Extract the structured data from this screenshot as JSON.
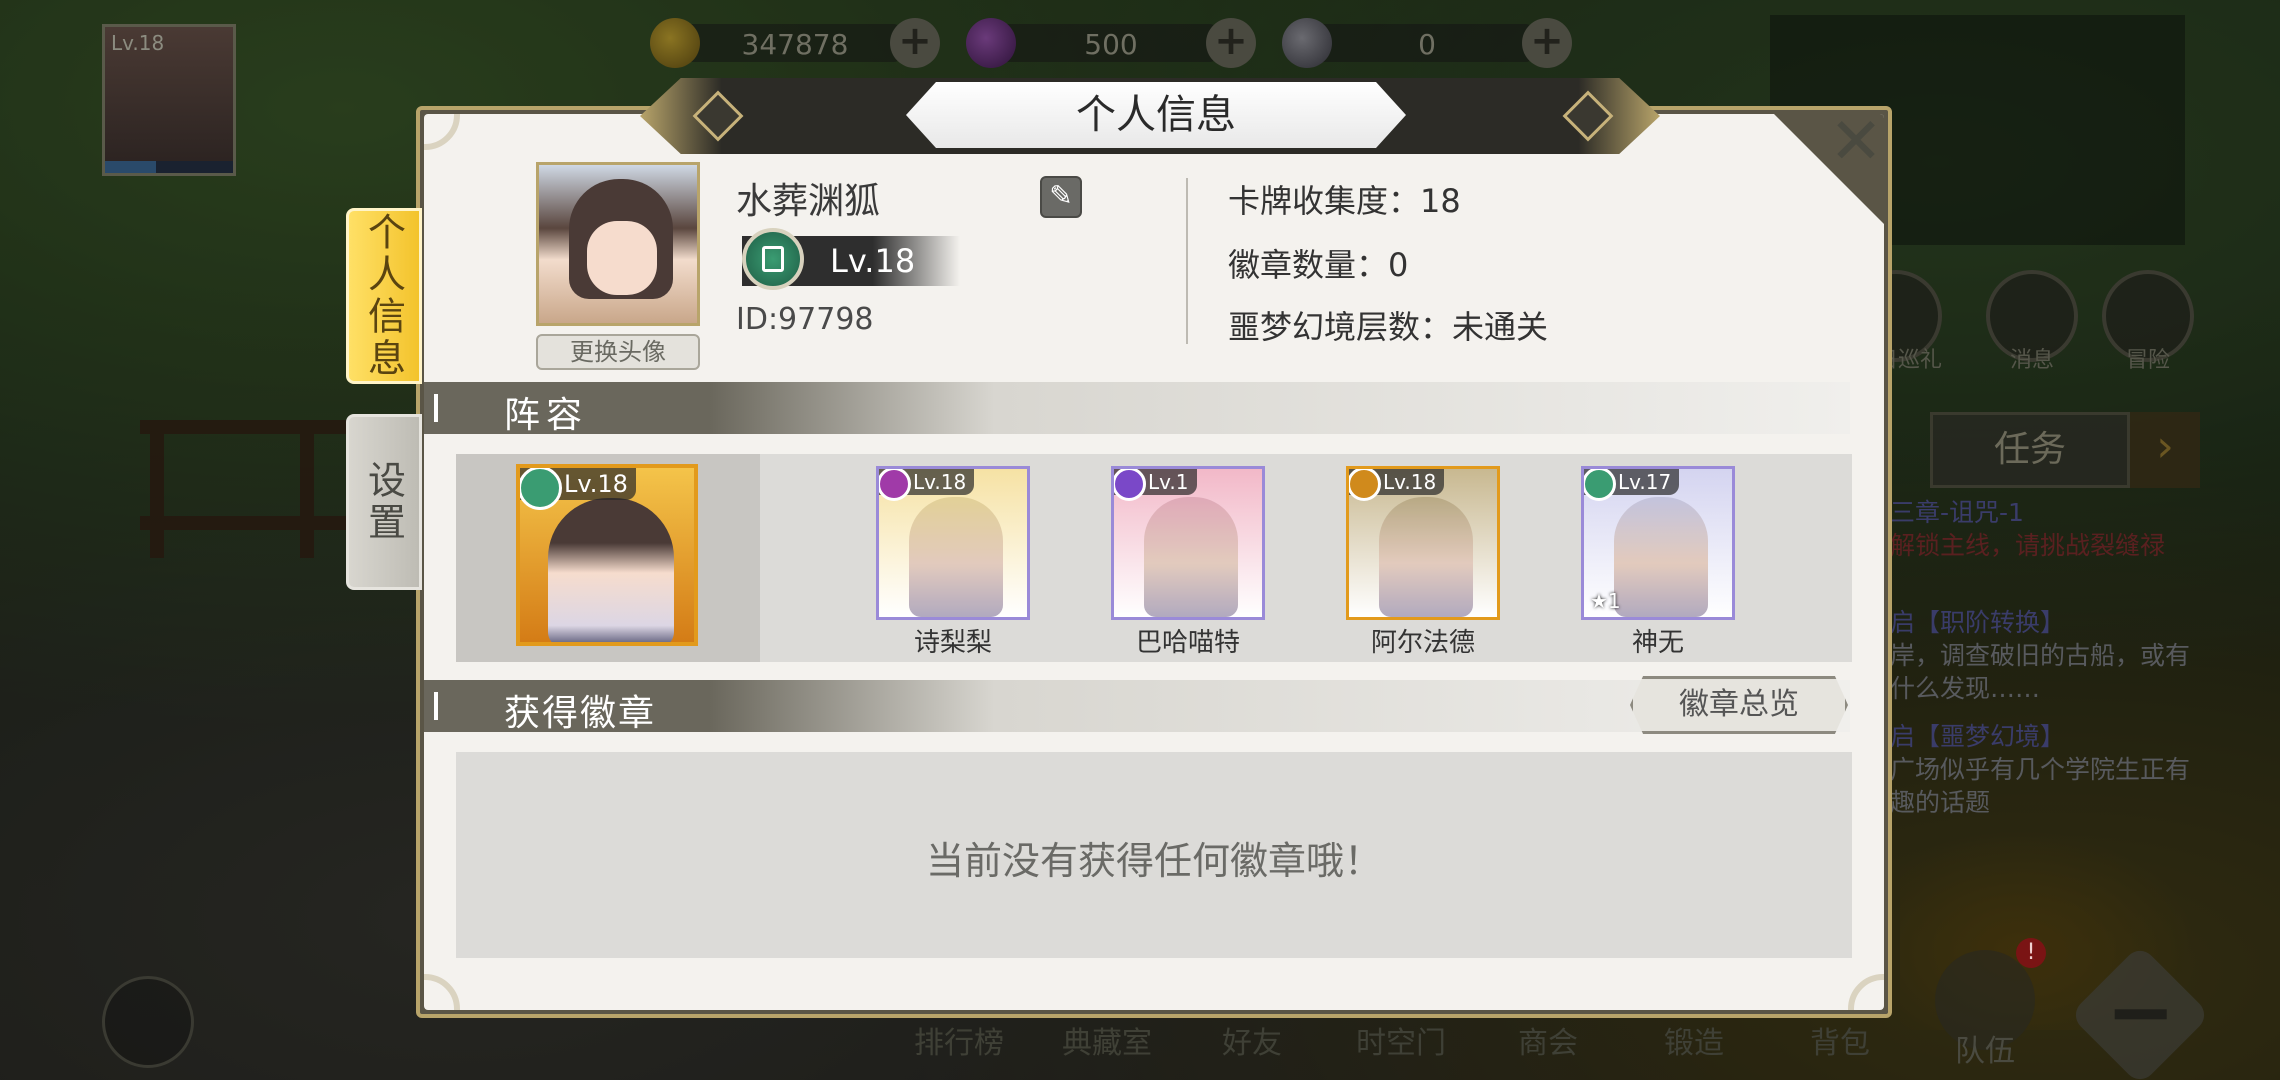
{
  "top_resources": [
    {
      "name": "gold",
      "value": "347878",
      "icon": "coin-icon"
    },
    {
      "name": "gem",
      "value": "500",
      "icon": "gem-icon"
    },
    {
      "name": "orb",
      "value": "0",
      "icon": "orb-icon"
    }
  ],
  "mini_profile": {
    "level": "Lv.18"
  },
  "hud": {
    "buttons": [
      "日巡礼",
      "消息",
      "冒险"
    ],
    "task_label": "任务",
    "quests": [
      {
        "title": "三章-诅咒-1",
        "desc": "解锁主线，请挑战裂缝禄"
      },
      {
        "title": "启【职阶转换】",
        "desc": "岸，调查破旧的古船，或有什么发现……"
      },
      {
        "title": "启【噩梦幻境】",
        "desc": "广场似乎有几个学院生正有趣的话题"
      }
    ],
    "bottom_nav": [
      "排行榜",
      "典藏室",
      "好友",
      "时空门",
      "商会",
      "锻造",
      "背包"
    ],
    "team_label": "队伍",
    "team_badge": "!"
  },
  "modal": {
    "title": "个人信息",
    "tabs": [
      {
        "label": "个人信息",
        "active": true
      },
      {
        "label": "设置",
        "active": false
      }
    ],
    "profile": {
      "name": "水葬渊狐",
      "level": "Lv.18",
      "id": "ID:97798",
      "change_avatar": "更换头像"
    },
    "stats": [
      "卡牌收集度：18",
      "徽章数量：0",
      "噩梦幻境层数：未通关"
    ],
    "lineup": {
      "header": "阵容",
      "leader": {
        "level": "Lv.18",
        "element_color": "#3a9c72"
      },
      "cards": [
        {
          "name": "诗梨梨",
          "level": "Lv.18",
          "element_color": "#a03aa8",
          "frame": "#9a8ad8",
          "bg": "#f6e2a4"
        },
        {
          "name": "巴哈喵特",
          "level": "Lv.1",
          "element_color": "#7a48c8",
          "frame": "#9a8ad8",
          "bg": "#f2b8c8"
        },
        {
          "name": "阿尔法德",
          "level": "Lv.18",
          "element_color": "#d08a1c",
          "frame": "#e29a1c",
          "bg": "#c8b890"
        },
        {
          "name": "神无",
          "level": "Lv.17",
          "element_color": "#3a9c72",
          "frame": "#9a8ad8",
          "bg": "#d4d4f0",
          "stars": "1"
        }
      ]
    },
    "badges": {
      "header": "获得徽章",
      "overview_button": "徽章总览",
      "empty_message": "当前没有获得任何徽章哦！"
    }
  }
}
